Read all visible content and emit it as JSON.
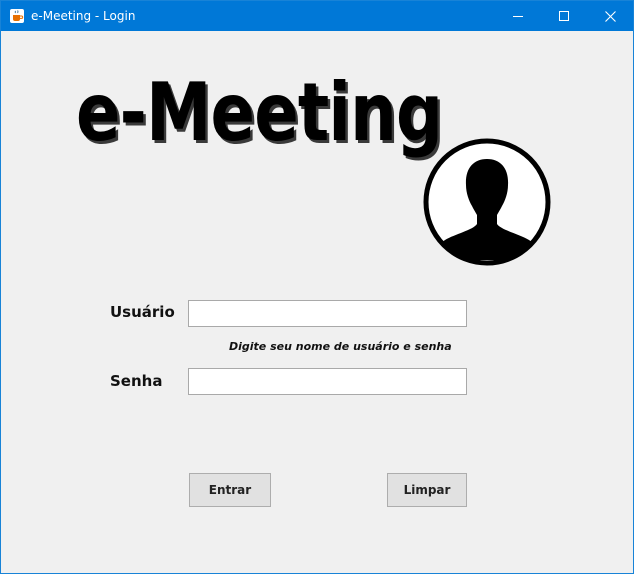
{
  "window": {
    "title": "e-Meeting - Login",
    "icon": "java-coffee-icon",
    "controls": [
      "minimize-icon",
      "maximize-icon",
      "close-icon"
    ]
  },
  "logo": {
    "text": "e-Meeting"
  },
  "avatar": {
    "icon": "user-silhouette-icon"
  },
  "form": {
    "user_label": "Usuário",
    "user_value": "",
    "hint": "Digite seu nome de usuário e senha",
    "password_label": "Senha",
    "password_value": ""
  },
  "buttons": {
    "enter_label": "Entrar",
    "clear_label": "Limpar"
  },
  "colors": {
    "titlebar": "#0078d7",
    "background": "#f0f0f0",
    "button": "#e1e1e1"
  }
}
